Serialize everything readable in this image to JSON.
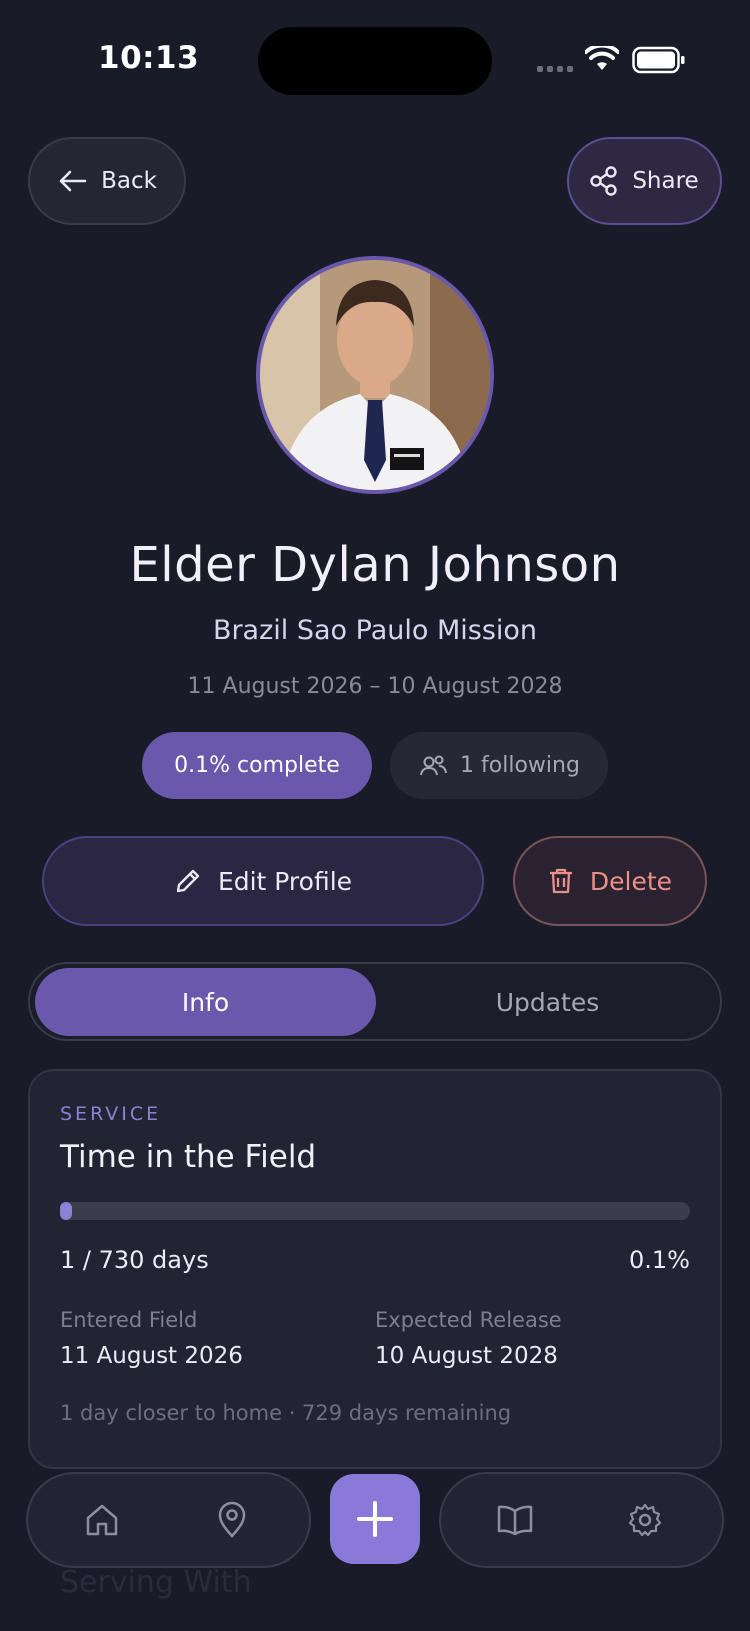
{
  "status_bar": {
    "time": "10:13"
  },
  "header": {
    "back_label": "Back",
    "share_label": "Share"
  },
  "profile": {
    "name": "Elder Dylan Johnson",
    "mission": "Brazil Sao Paulo Mission",
    "date_range": "11 August 2026 – 10 August 2028",
    "complete_label": "0.1% complete",
    "following_label": "1 following"
  },
  "actions": {
    "edit_label": "Edit Profile",
    "delete_label": "Delete"
  },
  "tabs": [
    {
      "label": "Info",
      "active": true
    },
    {
      "label": "Updates",
      "active": false
    }
  ],
  "service_card": {
    "eyebrow": "SERVICE",
    "title": "Time in the Field",
    "progress_fraction": 0.0014,
    "days_label": "1 / 730 days",
    "percent_label": "0.1%",
    "entered_label": "Entered Field",
    "entered_value": "11 August 2026",
    "release_label": "Expected Release",
    "release_value": "10 August 2028",
    "footer": "1 day closer to home · 729 days remaining"
  },
  "next_section": {
    "title": "Serving With"
  },
  "bottom_nav": {
    "items": [
      "home-icon",
      "map-pin-icon",
      "plus-icon",
      "book-icon",
      "gear-icon"
    ]
  },
  "colors": {
    "accent": "#6a58ad",
    "background": "#1a1b28",
    "danger": "#ec8f86"
  }
}
